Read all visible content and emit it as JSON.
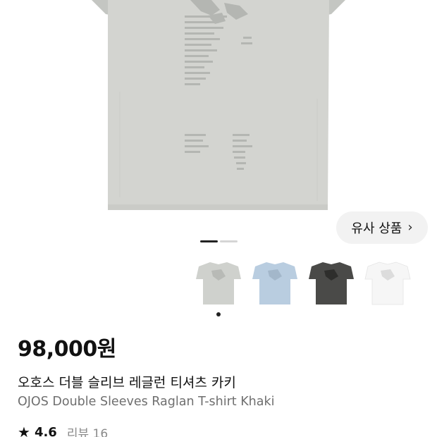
{
  "similar_products": {
    "label": "유사 상품",
    "chevron": "›"
  },
  "gallery": {
    "page_count": 2,
    "current_page": 1
  },
  "color_options": [
    {
      "name": "Khaki",
      "color": "#cfd1cd",
      "print": "#b8bab6",
      "selected": true
    },
    {
      "name": "Blue",
      "color": "#b9cde0",
      "print": "#a3b7ca",
      "selected": false
    },
    {
      "name": "Charcoal",
      "color": "#4a4a48",
      "print": "#2e2e2c",
      "selected": false
    },
    {
      "name": "White",
      "color": "#f6f6f6",
      "print": "#dcdcdc",
      "selected": false
    }
  ],
  "product": {
    "price": "98,000원",
    "name_ko": "오호스 더블 슬리브 레글런 티셔츠 카키",
    "name_en": "OJOS Double Sleeves Raglan T-shirt Khaki",
    "rating": "4.6",
    "reviews": "리뷰 16",
    "main_color": "#d3d4d0",
    "sleeve_color": "#c8c9c5"
  },
  "icons": {
    "star": "star-icon",
    "chevron": "chevron-right-icon"
  }
}
